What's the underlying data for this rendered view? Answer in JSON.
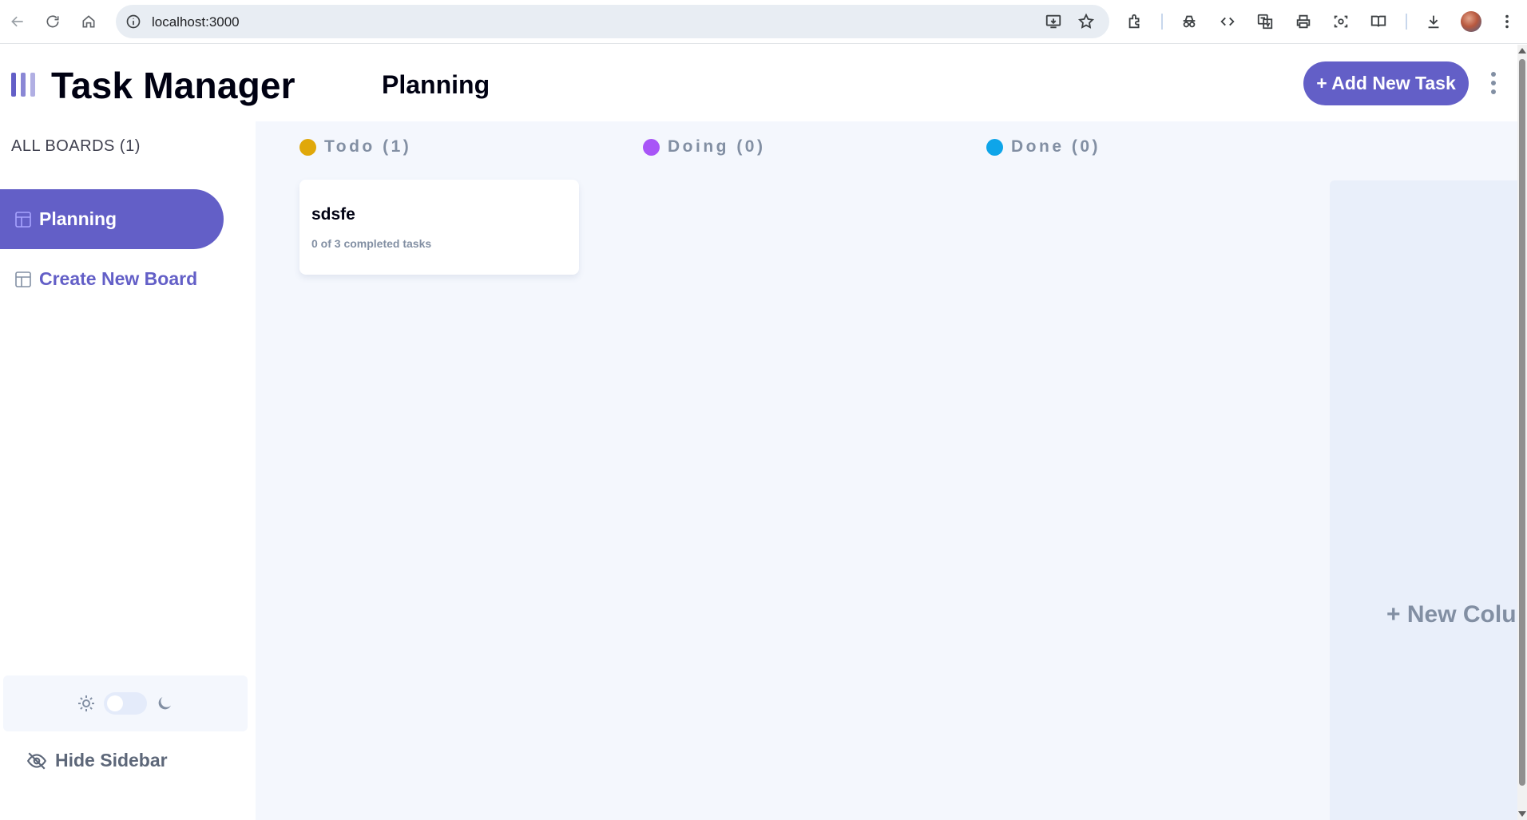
{
  "browser": {
    "url": "localhost:3000",
    "icons": [
      "back-icon",
      "reload-icon",
      "home-icon",
      "site-info-icon",
      "install-app-icon",
      "bookmark-star-icon",
      "extensions-icon",
      "incognito-icon",
      "devtools-code-icon",
      "translate-icon",
      "print-icon",
      "screenshot-icon",
      "reading-mode-icon",
      "download-icon",
      "profile-avatar",
      "browser-menu-icon"
    ]
  },
  "header": {
    "app_title": "Task Manager",
    "board_title": "Planning",
    "add_task_label": "+ Add New Task"
  },
  "sidebar": {
    "all_boards_label": "ALL BOARDS (1)",
    "boards": [
      {
        "label": "Planning",
        "active": true
      }
    ],
    "create_board_label": "Create New Board",
    "hide_sidebar_label": "Hide Sidebar",
    "theme": {
      "mode": "light"
    }
  },
  "columns": [
    {
      "label": "Todo (1)",
      "color": "#e0a80a",
      "tasks": [
        {
          "title": "sdsfe",
          "subtitle": "0 of 3 completed tasks"
        }
      ]
    },
    {
      "label": "Doing (0)",
      "color": "#a855f7",
      "tasks": []
    },
    {
      "label": "Done (0)",
      "color": "#0ea5e9",
      "tasks": []
    }
  ],
  "new_column_label": "+ New Colu",
  "colors": {
    "accent": "#635fc7",
    "board_bg": "#f4f7fd",
    "muted_text": "#828fa3"
  }
}
